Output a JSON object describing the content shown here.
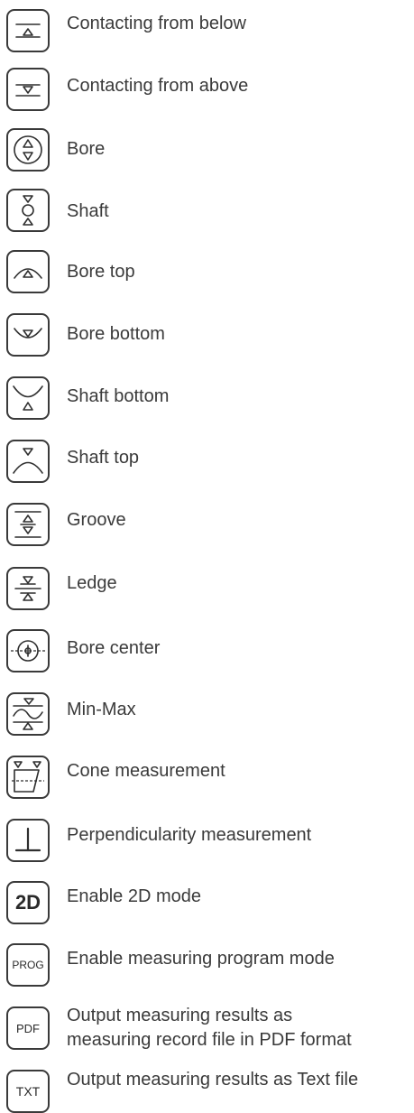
{
  "items": [
    {
      "icon": "contact-below-icon",
      "label": "Contacting from below"
    },
    {
      "icon": "contact-above-icon",
      "label": "Contacting from above"
    },
    {
      "icon": "bore-icon",
      "label": "Bore"
    },
    {
      "icon": "shaft-icon",
      "label": "Shaft"
    },
    {
      "icon": "bore-top-icon",
      "label": "Bore top"
    },
    {
      "icon": "bore-bottom-icon",
      "label": "Bore bottom"
    },
    {
      "icon": "shaft-bottom-icon",
      "label": "Shaft bottom"
    },
    {
      "icon": "shaft-top-icon",
      "label": "Shaft top"
    },
    {
      "icon": "groove-icon",
      "label": "Groove"
    },
    {
      "icon": "ledge-icon",
      "label": "Ledge"
    },
    {
      "icon": "bore-center-icon",
      "label": "Bore center"
    },
    {
      "icon": "min-max-icon",
      "label": "Min-Max"
    },
    {
      "icon": "cone-measurement-icon",
      "label": "Cone measurement"
    },
    {
      "icon": "perpendicularity-icon",
      "label": "Perpendicularity measurement"
    },
    {
      "icon": "2d-mode-icon",
      "label": "Enable 2D mode",
      "button_text": "2D"
    },
    {
      "icon": "program-mode-icon",
      "label": "Enable measuring program mode",
      "button_text": "PROG"
    },
    {
      "icon": "pdf-output-icon",
      "label": "Output measuring results as",
      "label_line2": "measuring record file in PDF format",
      "button_text": "PDF"
    },
    {
      "icon": "txt-output-icon",
      "label": "Output measuring results as Text file",
      "button_text": "TXT"
    }
  ],
  "colors": {
    "icon_stroke": "#2f2f2f",
    "text": "#3a3a3a",
    "background": "#ffffff"
  }
}
